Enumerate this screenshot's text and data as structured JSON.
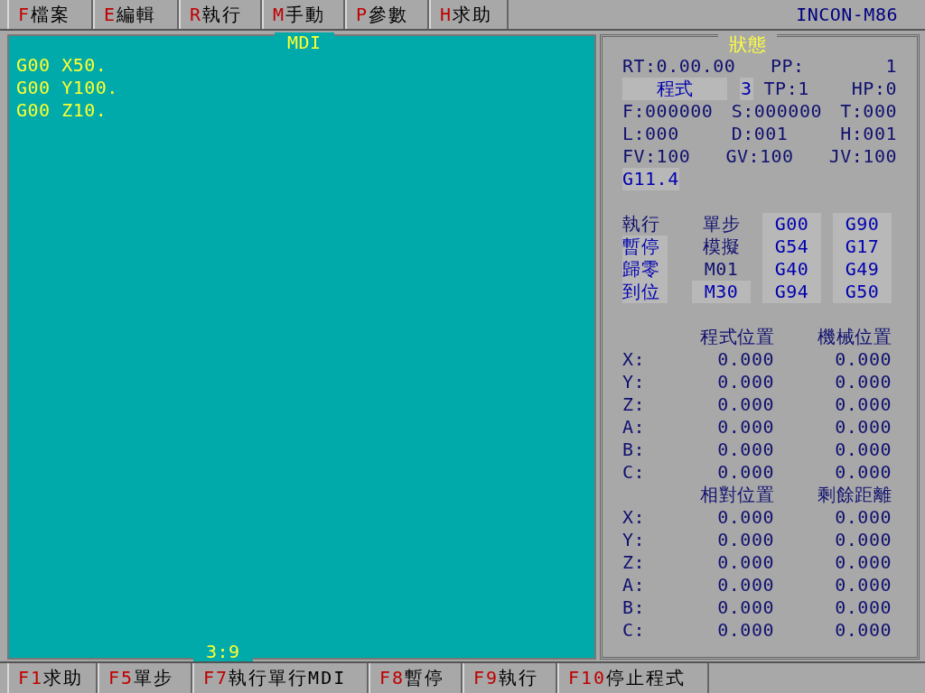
{
  "menu": [
    {
      "key": "F",
      "label": "檔案"
    },
    {
      "key": "E",
      "label": "編輯"
    },
    {
      "key": "R",
      "label": "執行"
    },
    {
      "key": "M",
      "label": "手動"
    },
    {
      "key": "P",
      "label": "參數"
    },
    {
      "key": "H",
      "label": "求助"
    }
  ],
  "brand": "INCON-M86",
  "editor": {
    "title": "MDI",
    "lines": [
      "G00 X50.",
      "G00 Y100.",
      "G00 Z10."
    ],
    "cursor": "3:9"
  },
  "status": {
    "title": "狀態",
    "rt": "RT:0.00.00",
    "pp_label": "PP:",
    "pp": "1",
    "mode": "程式",
    "mode_number": "3",
    "tp": "TP:1",
    "hp": "HP:0",
    "rows": [
      [
        "F:000000",
        "S:000000",
        "T:000"
      ],
      [
        "L:000",
        "D:001",
        "H:001"
      ],
      [
        "FV:100",
        "GV:100",
        "JV:100"
      ]
    ],
    "g_active": "G11.4",
    "flags": [
      [
        {
          "label": "執行",
          "highlighted": false
        },
        {
          "label": "暫停",
          "highlighted": true
        },
        {
          "label": "歸零",
          "highlighted": true
        },
        {
          "label": "到位",
          "highlighted": true
        }
      ],
      [
        {
          "label": "單步",
          "highlighted": false
        },
        {
          "label": "模擬",
          "highlighted": false
        },
        {
          "label": "M01",
          "highlighted": false
        },
        {
          "label": "M30",
          "highlighted": true
        }
      ]
    ],
    "modal_codes": [
      [
        "G00",
        "G54",
        "G40",
        "G94"
      ],
      [
        "G90",
        "G17",
        "G49",
        "G50"
      ]
    ],
    "positions": [
      {
        "headers": [
          "程式位置",
          "機械位置"
        ],
        "rows": [
          {
            "axis": "X:",
            "values": [
              "0.000",
              "0.000"
            ]
          },
          {
            "axis": "Y:",
            "values": [
              "0.000",
              "0.000"
            ]
          },
          {
            "axis": "Z:",
            "values": [
              "0.000",
              "0.000"
            ]
          },
          {
            "axis": "A:",
            "values": [
              "0.000",
              "0.000"
            ]
          },
          {
            "axis": "B:",
            "values": [
              "0.000",
              "0.000"
            ]
          },
          {
            "axis": "C:",
            "values": [
              "0.000",
              "0.000"
            ]
          }
        ]
      },
      {
        "headers": [
          "相對位置",
          "剩餘距離"
        ],
        "rows": [
          {
            "axis": "X:",
            "values": [
              "0.000",
              "0.000"
            ]
          },
          {
            "axis": "Y:",
            "values": [
              "0.000",
              "0.000"
            ]
          },
          {
            "axis": "Z:",
            "values": [
              "0.000",
              "0.000"
            ]
          },
          {
            "axis": "A:",
            "values": [
              "0.000",
              "0.000"
            ]
          },
          {
            "axis": "B:",
            "values": [
              "0.000",
              "0.000"
            ]
          },
          {
            "axis": "C:",
            "values": [
              "0.000",
              "0.000"
            ]
          }
        ]
      }
    ]
  },
  "function_keys": [
    {
      "key": "F1",
      "label": "求助"
    },
    {
      "key": "F5",
      "label": "單步"
    },
    {
      "key": "F7",
      "label": "執行單行MDI"
    },
    {
      "key": "F8",
      "label": "暫停"
    },
    {
      "key": "F9",
      "label": "執行"
    },
    {
      "key": "F10",
      "label": "停止程式"
    }
  ]
}
